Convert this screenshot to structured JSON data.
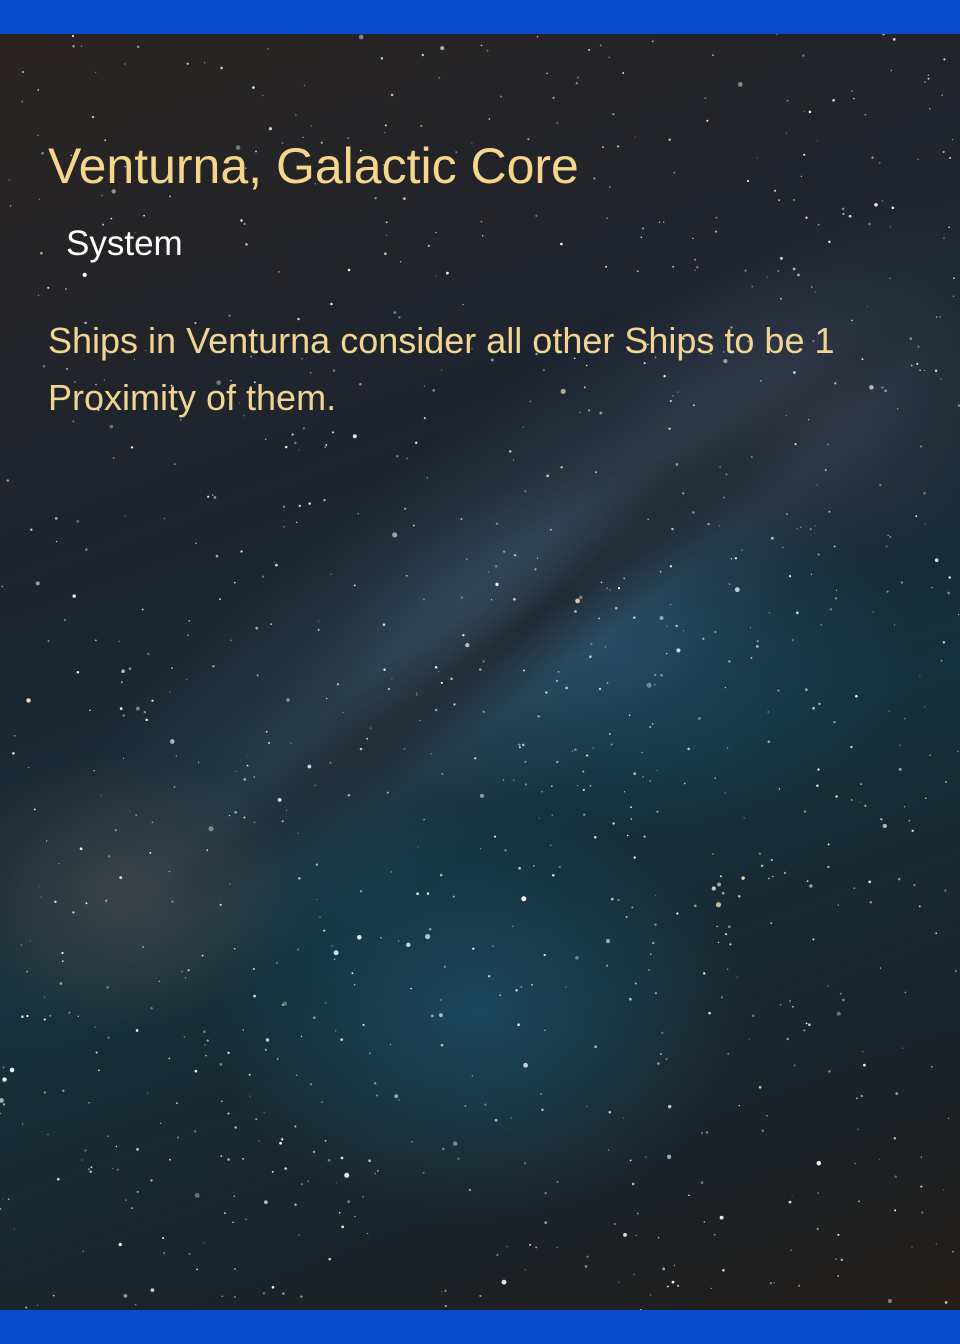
{
  "card": {
    "title": "Venturna, Galactic Core",
    "type": "System",
    "rules_text": "Ships in Venturna consider all other Ships to be 1 Proximity of them."
  },
  "colors": {
    "frame_bar": "#0a4bcc",
    "title_text": "#f5d68a",
    "type_text": "#ffffff",
    "rules_text": "#f1d592"
  }
}
